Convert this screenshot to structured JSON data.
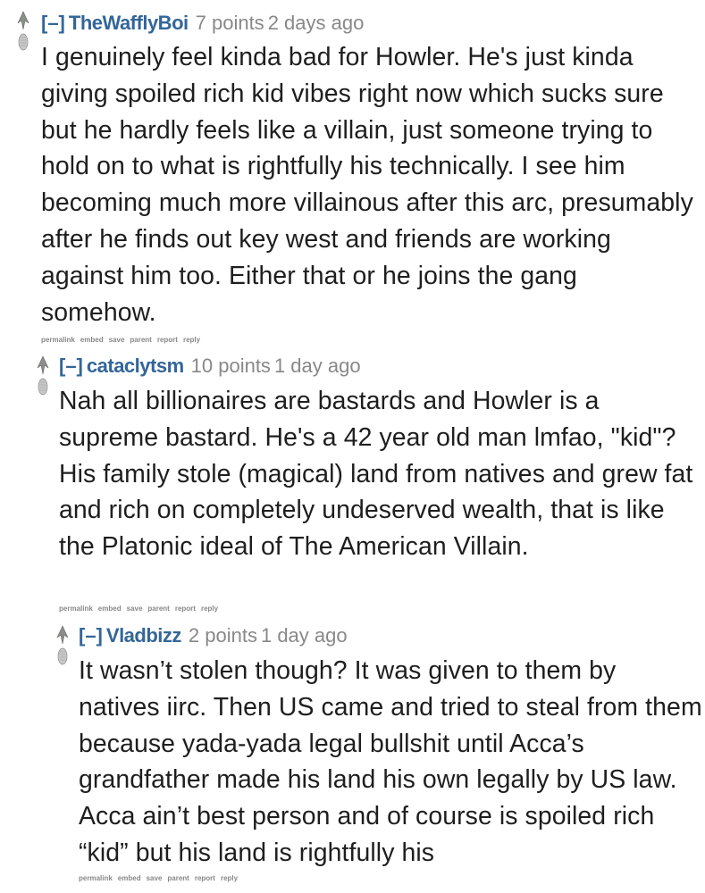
{
  "colors": {
    "author": "#336699",
    "meta": "#888888",
    "text": "#1e1e1e"
  },
  "actions": [
    "permalink",
    "embed",
    "save",
    "parent",
    "report",
    "reply"
  ],
  "comments": [
    {
      "expand": "[–]",
      "author": "TheWafflyBoi",
      "score": "7 points",
      "time": "2 days ago",
      "text": "I genuinely feel kinda bad for Howler. He's just kinda giving spoiled rich kid vibes right now which sucks sure but he hardly feels like a villain, just someone trying to hold on to what is rightfully his technically. I see him becoming much more villainous after this arc, presumably after he finds out key west and friends are working against him too. Either that or he joins the gang somehow."
    },
    {
      "expand": "[–]",
      "author": "cataclytsm",
      "score": "10 points",
      "time": "1 day ago",
      "text": "Nah all billionaires are bastards and Howler is a supreme bastard. He's a 42 year old man lmfao, \"kid\"? His family stole (magical) land from natives and grew fat and rich on completely undeserved wealth, that is like the Platonic ideal of The American Villain."
    },
    {
      "expand": "[–]",
      "author": "Vladbizz",
      "score": "2 points",
      "time": "1 day ago",
      "text": "It wasn’t stolen though? It was given to them by natives iirc. Then US came and tried to steal from them because yada-yada legal bullshit until Acca’s grandfather made his land his own legally by US law. Acca ain’t best person and of course is spoiled rich “kid” but his land is rightfully his"
    }
  ]
}
